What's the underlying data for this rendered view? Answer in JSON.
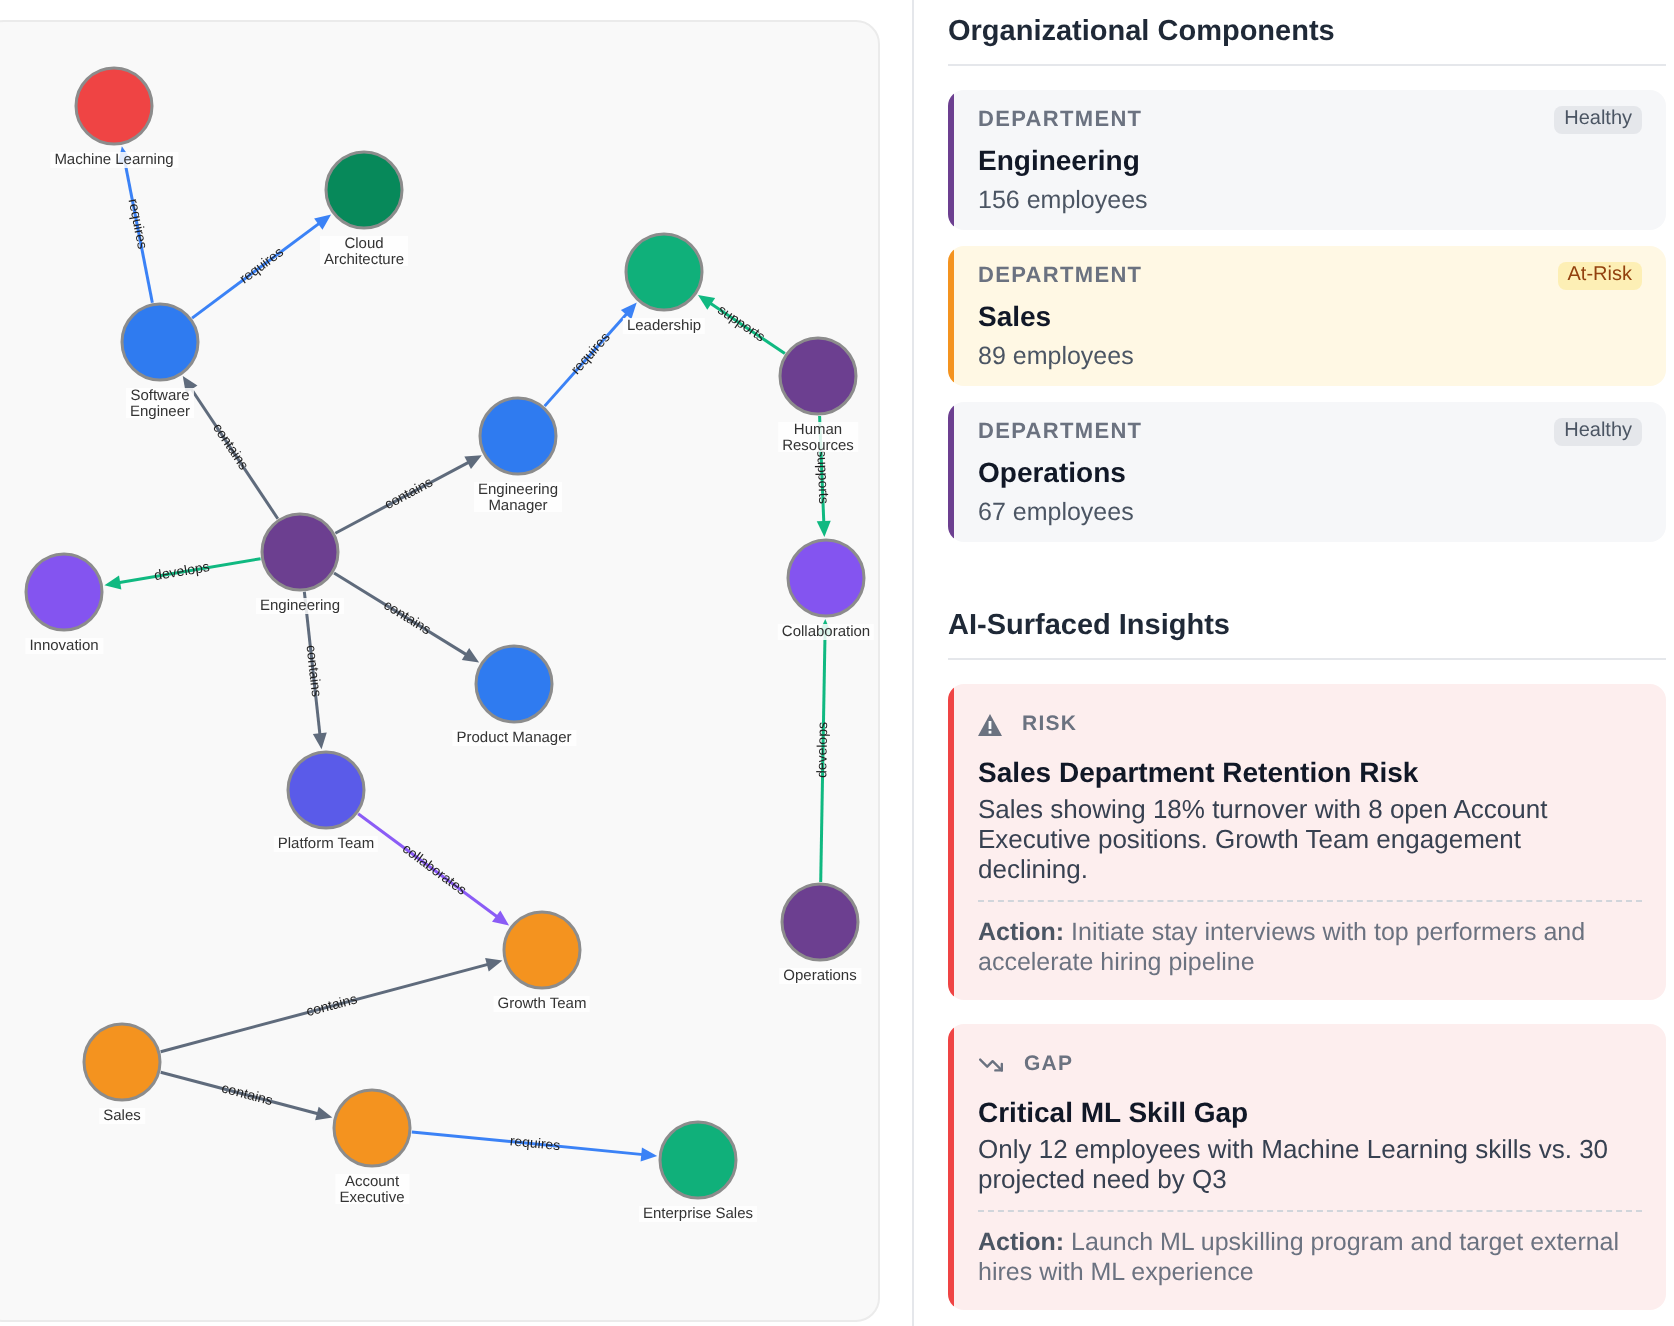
{
  "graph": {
    "nodes": [
      {
        "label": [
          "Machine Learning"
        ],
        "color": "#ef4444"
      },
      {
        "label": [
          "Cloud",
          "Architecture"
        ],
        "color": "#07895a"
      },
      {
        "label": [
          "Software",
          "Engineer"
        ],
        "color": "#2f7bf0"
      },
      {
        "label": [
          "Leadership"
        ],
        "color": "#10b07a"
      },
      {
        "label": [
          "Human",
          "Resources"
        ],
        "color": "#6c3f90"
      },
      {
        "label": [
          "Engineering",
          "Manager"
        ],
        "color": "#2f7bf0"
      },
      {
        "label": [
          "Engineering"
        ],
        "color": "#6c3f90"
      },
      {
        "label": [
          "Innovation"
        ],
        "color": "#8454f0"
      },
      {
        "label": [
          "Collaboration"
        ],
        "color": "#8454f0"
      },
      {
        "label": [
          "Product Manager"
        ],
        "color": "#2f7bf0"
      },
      {
        "label": [
          "Platform Team"
        ],
        "color": "#5a5be9"
      },
      {
        "label": [
          "Growth Team"
        ],
        "color": "#f4931f"
      },
      {
        "label": [
          "Operations"
        ],
        "color": "#6c3f90"
      },
      {
        "label": [
          "Sales"
        ],
        "color": "#f4931f"
      },
      {
        "label": [
          "Account",
          "Executive"
        ],
        "color": "#f4931f"
      },
      {
        "label": [
          "Enterprise Sales"
        ],
        "color": "#10b07a"
      }
    ],
    "edges": [
      {
        "label": "requires",
        "color": "#3b82f6"
      },
      {
        "label": "requires",
        "color": "#3b82f6"
      },
      {
        "label": "requires",
        "color": "#3b82f6"
      },
      {
        "label": "supports",
        "color": "#10b981"
      },
      {
        "label": "contains",
        "color": "#5f6b7c"
      },
      {
        "label": "contains",
        "color": "#5f6b7c"
      },
      {
        "label": "supports",
        "color": "#10b981"
      },
      {
        "label": "develops",
        "color": "#10b981"
      },
      {
        "label": "contains",
        "color": "#5f6b7c"
      },
      {
        "label": "contains",
        "color": "#5f6b7c"
      },
      {
        "label": "develops",
        "color": "#10b981"
      },
      {
        "label": "collaborates",
        "color": "#8b5cf6"
      },
      {
        "label": "contains",
        "color": "#5f6b7c"
      },
      {
        "label": "contains",
        "color": "#5f6b7c"
      },
      {
        "label": "requires",
        "color": "#3b82f6"
      }
    ]
  },
  "components": {
    "title": "Organizational Components",
    "items": [
      {
        "type": "DEPARTMENT",
        "name": "Engineering",
        "count": "156 employees",
        "status": "Healthy",
        "kind": "healthy",
        "color": "#6c3f90"
      },
      {
        "type": "DEPARTMENT",
        "name": "Sales",
        "count": "89 employees",
        "status": "At-Risk",
        "kind": "at-risk",
        "color": "#f4931f"
      },
      {
        "type": "DEPARTMENT",
        "name": "Operations",
        "count": "67 employees",
        "status": "Healthy",
        "kind": "healthy",
        "color": "#6c3f90"
      }
    ]
  },
  "insights": {
    "title": "AI-Surfaced Insights",
    "items": [
      {
        "kind": "risk",
        "tag": "RISK",
        "title": "Sales Department Retention Risk",
        "text": "Sales showing 18% turnover with 8 open Account Executive positions. Growth Team engagement declining.",
        "action": "**Action:** Initiate stay interviews with top performers and accelerate hiring pipeline"
      },
      {
        "kind": "gap",
        "tag": "GAP",
        "title": "Critical ML Skill Gap",
        "text": "Only 12 employees with Machine Learning skills vs. 30 projected need by Q3",
        "action": "**Action:** Launch ML upskilling program and target external hires with ML experience"
      }
    ]
  }
}
